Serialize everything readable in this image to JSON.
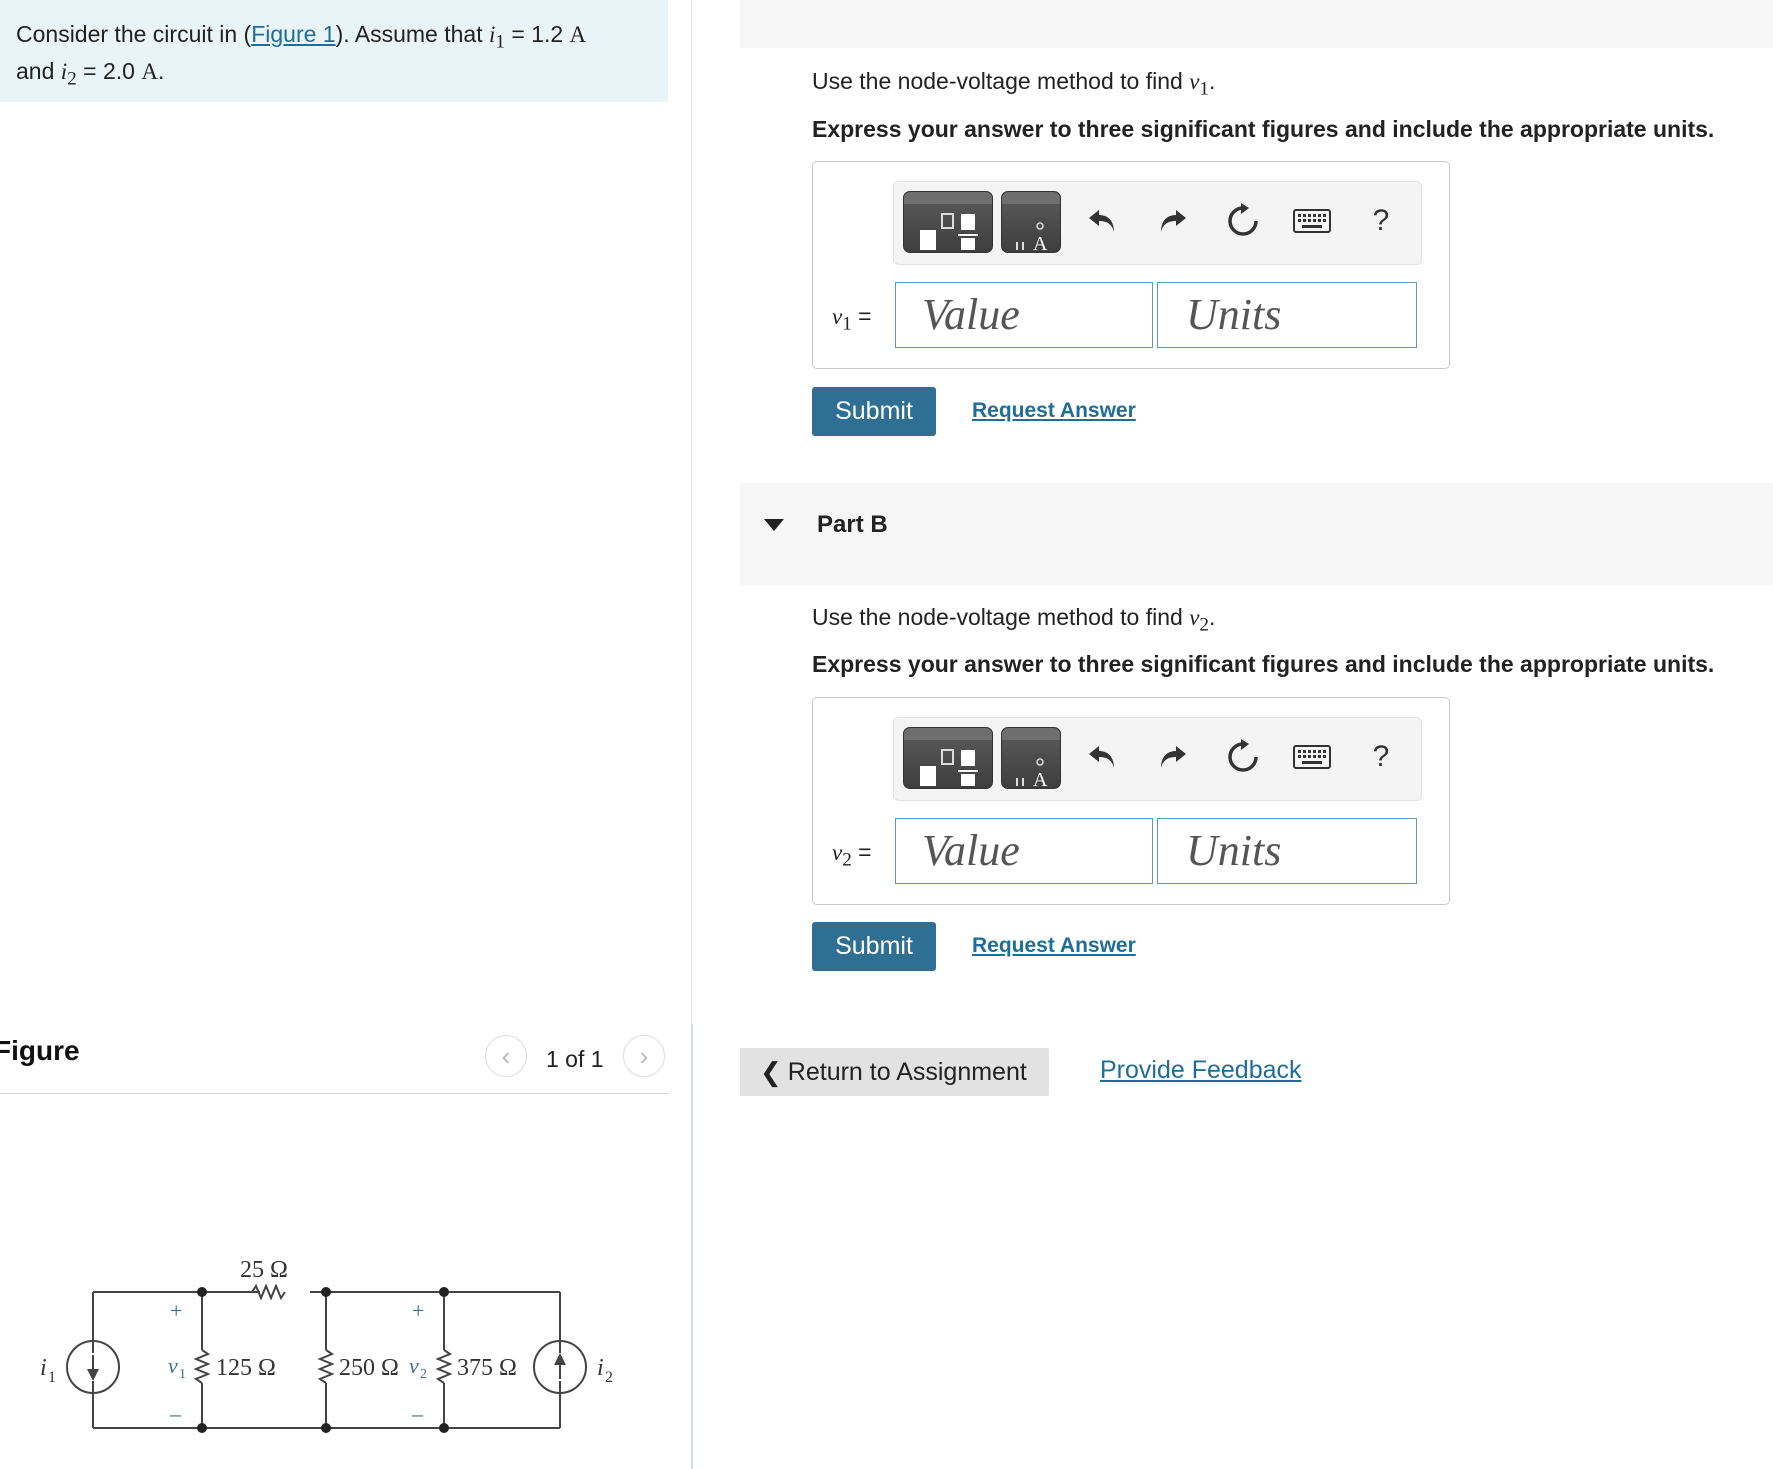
{
  "problem": {
    "prefix": "Consider the circuit in (",
    "figure_link": "Figure 1",
    "middle": "). Assume that ",
    "i1_var": "i",
    "i1_sub": "1",
    "i1_value": " = 1.2 ",
    "i1_unit": "A",
    "and_text": "and ",
    "i2_var": "i",
    "i2_sub": "2",
    "i2_value": " = 2.0 ",
    "i2_unit": "A",
    "period": "."
  },
  "figure": {
    "title": "Figure",
    "count": "1 of 1",
    "prev_icon": "chevron-left-icon",
    "next_icon": "chevron-right-icon",
    "circuit": {
      "r_series": "25 Ω",
      "r1": "125 Ω",
      "r2": "250 Ω",
      "r3": "375 Ω",
      "source_left": "i",
      "source_left_sub": "1",
      "source_right": "i",
      "source_right_sub": "2",
      "v1_label": "v",
      "v1_sub": "1",
      "v2_label": "v",
      "v2_sub": "2",
      "plus": "+",
      "minus": "–"
    }
  },
  "part_a": {
    "prompt_text": "Use the node-voltage method to find ",
    "prompt_var": "v",
    "prompt_sub": "1",
    "prompt_end": ".",
    "instruction": "Express your answer to three significant figures and include the appropriate units.",
    "var_label": "v",
    "var_sub": "1",
    "eq": " =",
    "value_placeholder": "Value",
    "units_placeholder": "Units",
    "submit": "Submit",
    "request": "Request Answer"
  },
  "part_b": {
    "title": "Part B",
    "prompt_text": "Use the node-voltage method to find ",
    "prompt_var": "v",
    "prompt_sub": "2",
    "prompt_end": ".",
    "instruction": "Express your answer to three significant figures and include the appropriate units.",
    "var_label": "v",
    "var_sub": "2",
    "eq": " =",
    "value_placeholder": "Value",
    "units_placeholder": "Units",
    "submit": "Submit",
    "request": "Request Answer"
  },
  "toolbar": {
    "help": "?",
    "icons": [
      "templates-icon",
      "symbols-icon",
      "undo-icon",
      "redo-icon",
      "reset-icon",
      "keyboard-icon",
      "help-icon"
    ]
  },
  "footer": {
    "return": "Return to Assignment",
    "feedback": "Provide Feedback"
  }
}
